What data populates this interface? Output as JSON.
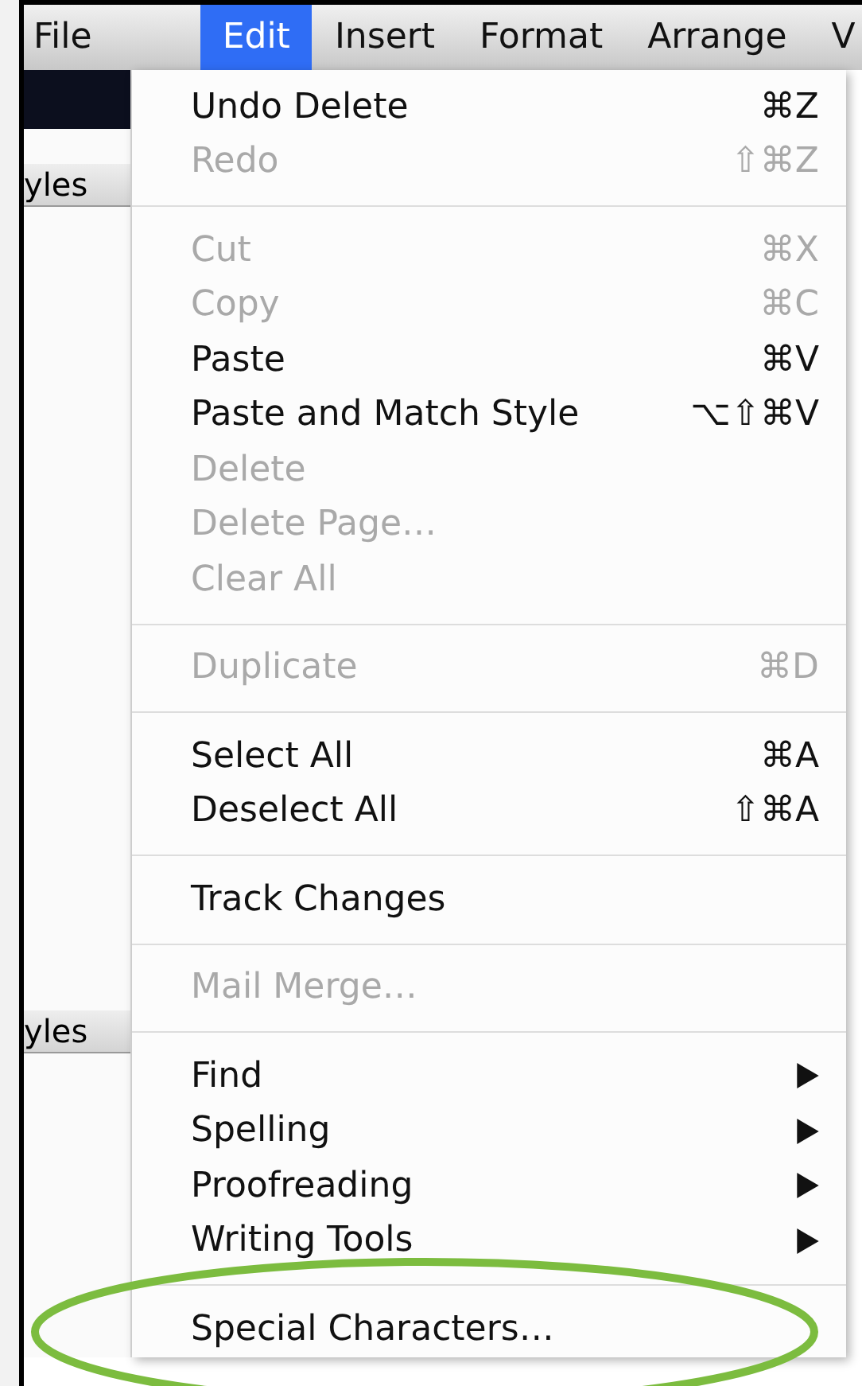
{
  "menu_bar": [
    {
      "label": "File",
      "selected": false
    },
    {
      "label": "Edit",
      "selected": true
    },
    {
      "label": "Insert",
      "selected": false
    },
    {
      "label": "Format",
      "selected": false
    },
    {
      "label": "Arrange",
      "selected": false
    },
    {
      "label": "V",
      "selected": false
    }
  ],
  "sidebar": {
    "headers": [
      "yles",
      "yles"
    ]
  },
  "menu": {
    "sections": [
      [
        {
          "label": "Undo Delete",
          "shortcut": "⌘Z",
          "disabled": false,
          "submenu": false
        },
        {
          "label": "Redo",
          "shortcut": "⇧⌘Z",
          "disabled": true,
          "submenu": false
        }
      ],
      [
        {
          "label": "Cut",
          "shortcut": "⌘X",
          "disabled": true,
          "submenu": false
        },
        {
          "label": "Copy",
          "shortcut": "⌘C",
          "disabled": true,
          "submenu": false
        },
        {
          "label": "Paste",
          "shortcut": "⌘V",
          "disabled": false,
          "submenu": false
        },
        {
          "label": "Paste and Match Style",
          "shortcut": "⌥⇧⌘V",
          "disabled": false,
          "submenu": false
        },
        {
          "label": "Delete",
          "disabled": true,
          "submenu": false
        },
        {
          "label": "Delete Page…",
          "disabled": true,
          "submenu": false
        },
        {
          "label": "Clear All",
          "disabled": true,
          "submenu": false
        }
      ],
      [
        {
          "label": "Duplicate",
          "shortcut": "⌘D",
          "disabled": true,
          "submenu": false
        }
      ],
      [
        {
          "label": "Select All",
          "shortcut": "⌘A",
          "disabled": false,
          "submenu": false
        },
        {
          "label": "Deselect All",
          "shortcut": "⇧⌘A",
          "disabled": false,
          "submenu": false
        }
      ],
      [
        {
          "label": "Track Changes",
          "disabled": false,
          "submenu": false
        }
      ],
      [
        {
          "label": "Mail Merge…",
          "disabled": true,
          "submenu": false
        }
      ],
      [
        {
          "label": "Find",
          "disabled": false,
          "submenu": true
        },
        {
          "label": "Spelling",
          "disabled": false,
          "submenu": true
        },
        {
          "label": "Proofreading",
          "disabled": false,
          "submenu": true
        },
        {
          "label": "Writing Tools",
          "disabled": false,
          "submenu": true
        }
      ],
      [
        {
          "label": "Special Characters…",
          "disabled": false,
          "submenu": false,
          "highlighted": true
        }
      ]
    ]
  }
}
